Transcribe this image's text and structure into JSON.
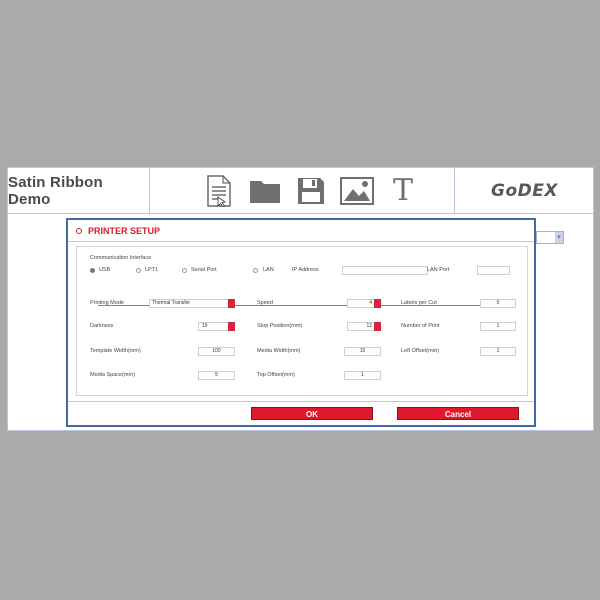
{
  "app": {
    "title": "Satin Ribbon Demo",
    "logo": "GoDEX",
    "toolbar_icons": [
      "document-icon",
      "folder-icon",
      "save-icon",
      "image-icon",
      "text-icon"
    ],
    "toolbar_text_glyph": "T"
  },
  "dialog": {
    "title": "PRINTER SETUP",
    "communication": {
      "heading": "Communication Interface",
      "options": [
        "USB",
        "LPT1",
        "Serial Port",
        "LAN"
      ],
      "selected": "USB",
      "ip_label": "IP Address",
      "ip_value": "",
      "lan_port_label": "LAN Port",
      "lan_port_value": ""
    },
    "settings": {
      "printing_mode_label": "Printing Mode",
      "printing_mode_value": "Thermal Transfer",
      "speed_label": "Speed",
      "speed_value": "4",
      "labels_per_cut_label": "Labels per Cut",
      "labels_per_cut_value": "0",
      "darkness_label": "Darkness",
      "darkness_value": "15",
      "stop_position_label": "Stop Position(mm)",
      "stop_position_value": "12",
      "number_of_print_label": "Number of Print",
      "number_of_print_value": "1",
      "template_width_label": "Template Width(mm)",
      "template_width_value": "100",
      "media_width_label": "Media Width(mm)",
      "media_width_value": "15",
      "left_offset_label": "Left Offset(mm)",
      "left_offset_value": "1",
      "media_space_label": "Media Space(mm)",
      "media_space_value": "5",
      "top_offset_label": "Top Offset(mm)",
      "top_offset_value": "1"
    },
    "ok_label": "OK",
    "cancel_label": "Cancel"
  },
  "colors": {
    "accent_red": "#e0182e",
    "dialog_border": "#4667a8",
    "background": "#aaaaaa"
  }
}
